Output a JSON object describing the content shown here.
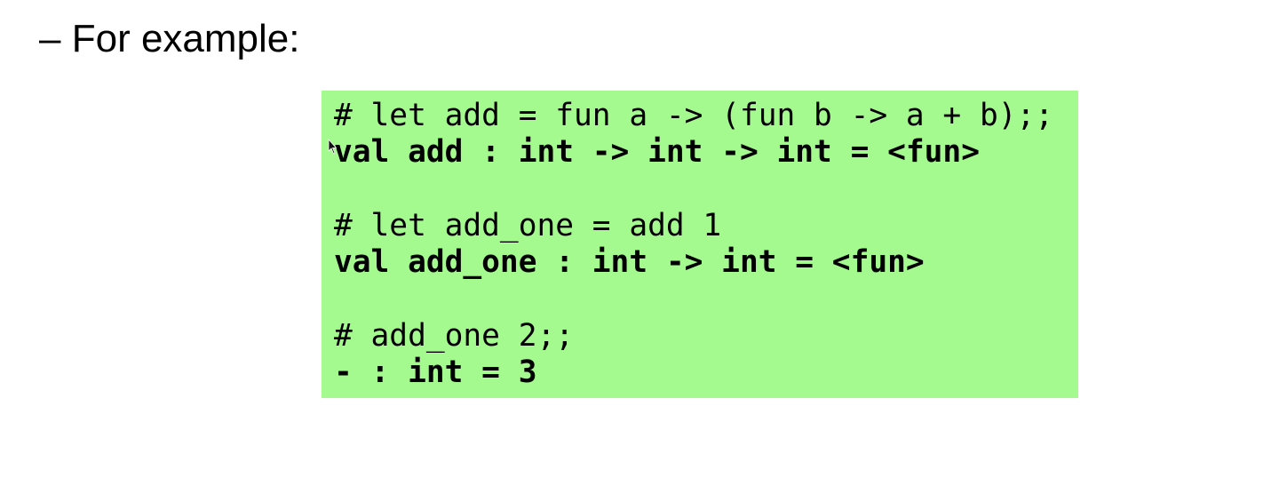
{
  "slide": {
    "bullet_dash": "–",
    "bullet_text": "For example:"
  },
  "code_block": {
    "lines": [
      {
        "text": "# let add = fun a -> (fun b -> a + b);;",
        "kind": "input"
      },
      {
        "text": "val add : int -> int -> int = <fun>",
        "kind": "output"
      },
      {
        "text": "",
        "kind": "blank"
      },
      {
        "text": "# let add_one = add 1",
        "kind": "input"
      },
      {
        "text": "val add_one : int -> int = <fun>",
        "kind": "output"
      },
      {
        "text": "",
        "kind": "blank"
      },
      {
        "text": "# add_one 2;;",
        "kind": "input"
      },
      {
        "text": "- : int = 3",
        "kind": "output"
      }
    ],
    "background_color": "#a4f98f"
  },
  "cursor": {
    "icon": "mouse-pointer-icon"
  }
}
